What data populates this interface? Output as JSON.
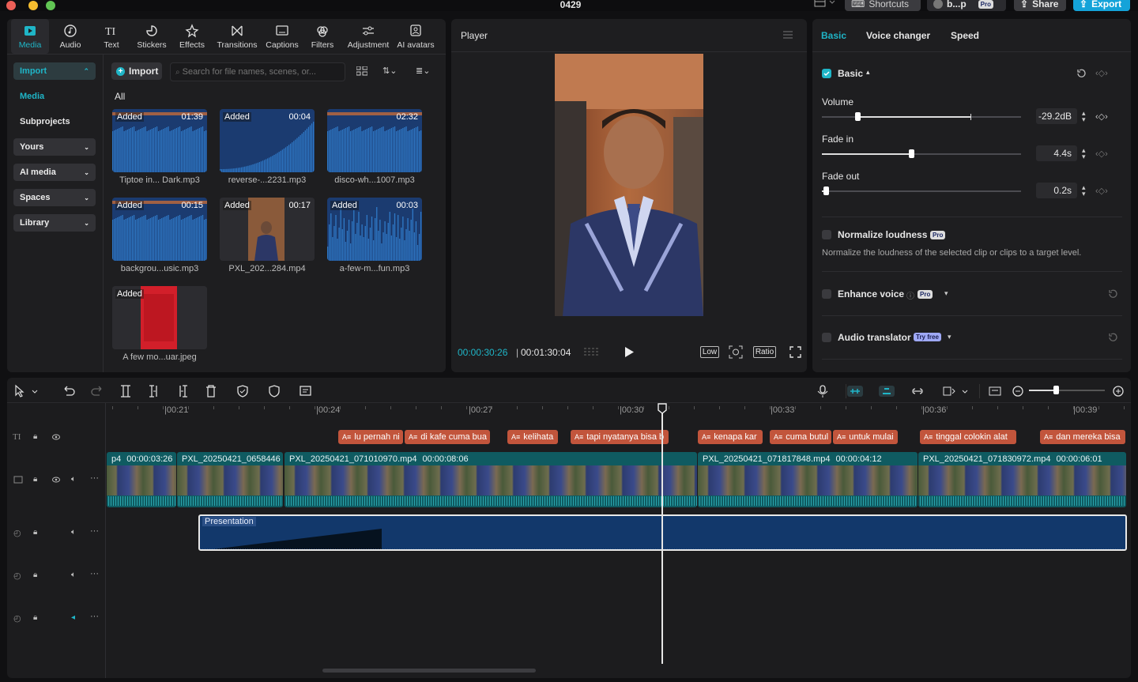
{
  "window": {
    "title": "0429"
  },
  "header": {
    "shortcuts_label": "Shortcuts",
    "project_label": "b...p",
    "pro_badge": "Pro",
    "share_label": "Share",
    "export_label": "Export"
  },
  "tabs": [
    {
      "label": "Media",
      "icon": "media-icon"
    },
    {
      "label": "Audio",
      "icon": "audio-icon"
    },
    {
      "label": "Text",
      "icon": "text-icon"
    },
    {
      "label": "Stickers",
      "icon": "stickers-icon"
    },
    {
      "label": "Effects",
      "icon": "effects-icon"
    },
    {
      "label": "Transitions",
      "icon": "transitions-icon"
    },
    {
      "label": "Captions",
      "icon": "captions-icon"
    },
    {
      "label": "Filters",
      "icon": "filters-icon"
    },
    {
      "label": "Adjustment",
      "icon": "adjustment-icon"
    },
    {
      "label": "AI avatars",
      "icon": "ai-avatars-icon"
    }
  ],
  "sidebar": {
    "items": [
      {
        "label": "Import",
        "expanded": true
      },
      {
        "label": "Media"
      },
      {
        "label": "Subprojects"
      },
      {
        "label": "Yours"
      },
      {
        "label": "AI media"
      },
      {
        "label": "Spaces"
      },
      {
        "label": "Library"
      }
    ]
  },
  "media": {
    "import_label": "Import",
    "search_placeholder": "Search for file names, scenes, or...",
    "filter_label": "All",
    "items": [
      {
        "added": "Added",
        "duration": "01:39",
        "name": "Tiptoe in... Dark.mp3",
        "kind": "audio"
      },
      {
        "added": "Added",
        "duration": "00:04",
        "name": "reverse-...2231.mp3",
        "kind": "audio-ramp"
      },
      {
        "added": "",
        "duration": "02:32",
        "name": "disco-wh...1007.mp3",
        "kind": "audio"
      },
      {
        "added": "Added",
        "duration": "00:15",
        "name": "backgrou...usic.mp3",
        "kind": "audio"
      },
      {
        "added": "Added",
        "duration": "00:17",
        "name": "PXL_202...284.mp4",
        "kind": "video"
      },
      {
        "added": "Added",
        "duration": "00:03",
        "name": "a-few-m...fun.mp3",
        "kind": "audio-sparse"
      },
      {
        "added": "Added",
        "duration": "",
        "name": "A few mo...uar.jpeg",
        "kind": "image"
      }
    ]
  },
  "player": {
    "title": "Player",
    "current_time": "00:00:30:26",
    "total_time": "00:01:30:04",
    "quality_label": "Low",
    "ratio_label": "Ratio"
  },
  "inspector": {
    "tabs": [
      "Basic",
      "Voice changer",
      "Speed"
    ],
    "section_label": "Basic",
    "volume": {
      "label": "Volume",
      "value": "-29.2dB",
      "level": 0.18
    },
    "fade_in": {
      "label": "Fade in",
      "value": "4.4s",
      "level": 0.45
    },
    "fade_out": {
      "label": "Fade out",
      "value": "0.2s",
      "level": 0.02
    },
    "normalize": {
      "label": "Normalize loudness",
      "badge": "Pro",
      "description": "Normalize the loudness of the selected clip or clips to a target level."
    },
    "enhance": {
      "label": "Enhance voice",
      "badge": "Pro"
    },
    "translator": {
      "label": "Audio translator",
      "badge": "Try free"
    }
  },
  "timeline": {
    "ruler": [
      "|00:21",
      "|00:24",
      "|00:27",
      "|00:30",
      "|00:33",
      "|00:36",
      "|00:39"
    ],
    "subtitles": [
      "lu pernah ni",
      "di kafe cuma bua",
      "kelihata",
      "tapi nyatanya bisa b",
      "kenapa kar",
      "cuma butul",
      "untuk mulai",
      "tinggal colokin alat",
      "dan mereka bisa"
    ],
    "video_clips": [
      {
        "name": "p4",
        "duration": "00:00:03:26"
      },
      {
        "name": "PXL_20250421_0658446",
        "duration": ""
      },
      {
        "name": "PXL_20250421_071010970.mp4",
        "duration": "00:00:08:06"
      },
      {
        "name": "PXL_20250421_071817848.mp4",
        "duration": "00:00:04:12"
      },
      {
        "name": "PXL_20250421_071830972.mp4",
        "duration": "00:00:06:01"
      }
    ],
    "audio_clip": {
      "name": "Presentation"
    }
  },
  "colors": {
    "accent": "#1fb5c7",
    "export": "#14a3d9",
    "subtitle": "#c2553c",
    "video": "#0f5b61",
    "audio": "#12386b"
  }
}
